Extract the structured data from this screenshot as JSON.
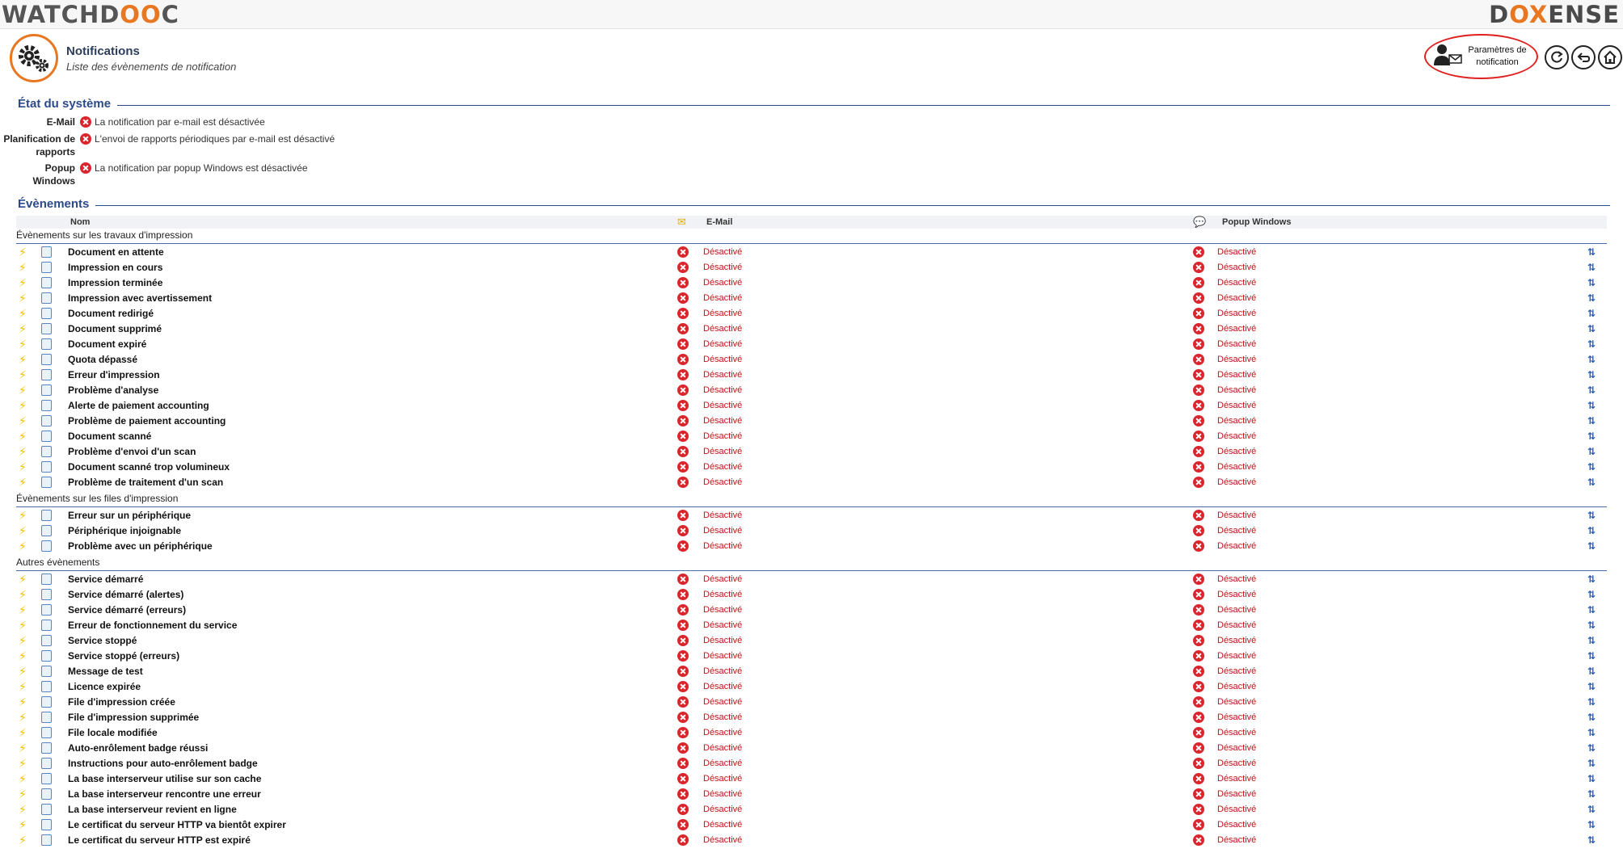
{
  "brand": {
    "left_logo": [
      "WATCHD",
      "OO",
      "C"
    ],
    "right_logo": [
      "D",
      "OX",
      "ENSE"
    ],
    "accent": "#e87722"
  },
  "header": {
    "title": "Notifications",
    "subtitle": "Liste des évènements de notification",
    "notif_button": "Paramètres de notification"
  },
  "system": {
    "title": "État du système",
    "rows": [
      {
        "label": "E-Mail",
        "text": "La notification par e-mail est désactivée"
      },
      {
        "label": "Planification de rapports",
        "text": "L'envoi de rapports périodiques par e-mail est désactivé"
      },
      {
        "label": "Popup Windows",
        "text": "La notification par popup Windows est désactivée"
      }
    ]
  },
  "events": {
    "title": "Évènements",
    "columns": {
      "name": "Nom",
      "email": "E-Mail",
      "popup": "Popup Windows"
    },
    "status_value": "Désactivé",
    "groups": [
      {
        "title": "Évènements sur les travaux d'impression",
        "items": [
          "Document en attente",
          "Impression en cours",
          "Impression terminée",
          "Impression avec avertissement",
          "Document redirigé",
          "Document supprimé",
          "Document expiré",
          "Quota dépassé",
          "Erreur d'impression",
          "Problème d'analyse",
          "Alerte de paiement accounting",
          "Problème de paiement accounting",
          "Document scanné",
          "Problème d'envoi d'un scan",
          "Document scanné trop volumineux",
          "Problème de traitement d'un scan"
        ]
      },
      {
        "title": "Évènements sur les files d'impression",
        "items": [
          "Erreur sur un périphérique",
          "Périphérique injoignable",
          "Problème avec un périphérique"
        ]
      },
      {
        "title": "Autres évènements",
        "items": [
          "Service démarré",
          "Service démarré (alertes)",
          "Service démarré (erreurs)",
          "Erreur de fonctionnement du service",
          "Service stoppé",
          "Service stoppé (erreurs)",
          "Message de test",
          "Licence expirée",
          "File d'impression créée",
          "File d'impression supprimée",
          "File locale modifiée",
          "Auto-enrôlement badge réussi",
          "Instructions pour auto-enrôlement badge",
          "La base interserveur utilise sur son cache",
          "La base interserveur rencontre une erreur",
          "La base interserveur revient en ligne",
          "Le certificat du serveur HTTP va bientôt expirer",
          "Le certificat du serveur HTTP est expiré"
        ]
      }
    ]
  }
}
